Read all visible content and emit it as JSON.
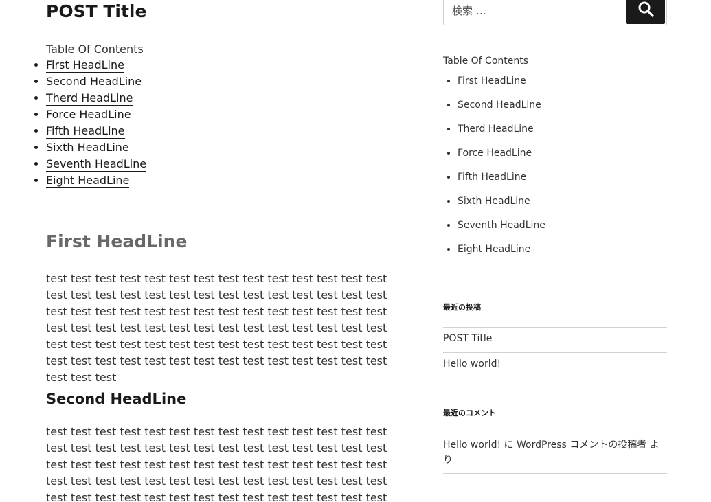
{
  "post": {
    "title": "POST Title",
    "toc_heading": "Table Of Contents",
    "toc_items": [
      "First HeadLine",
      "Second HeadLine",
      "Therd HeadLine",
      "Force HeadLine",
      "Fifth HeadLine",
      "Sixth HeadLine",
      "Seventh HeadLine",
      "Eight HeadLine"
    ],
    "sections": [
      {
        "heading": "First HeadLine",
        "body": "test test test test test test test test test test test test test test test test test test test test test test test test test test test test test test test test test test test test test test test test test test test test test test test test test test test test test test test test test test test test test test test test test test test test test test test test test test test test test test test test test test test test test test test"
      },
      {
        "heading": "Second HeadLine",
        "body": "test test test test test test test test test test test test test test test test test test test test test test test test test test test test test test test test test test test test test test test test test test test test test test test test test test test test test test test test test test test test test test test test test test test test test test"
      }
    ]
  },
  "sidebar": {
    "search": {
      "placeholder": "検索 …",
      "icon": "search-icon"
    },
    "toc_heading": "Table Of Contents",
    "toc_items": [
      "First HeadLine",
      "Second HeadLine",
      "Therd HeadLine",
      "Force HeadLine",
      "Fifth HeadLine",
      "Sixth HeadLine",
      "Seventh HeadLine",
      "Eight HeadLine"
    ],
    "recent_posts": {
      "title": "最近の投稿",
      "items": [
        "POST Title",
        "Hello world!"
      ]
    },
    "recent_comments": {
      "title": "最近のコメント",
      "items": [
        "Hello world! に WordPress コメントの投稿者 より"
      ]
    }
  },
  "colors": {
    "text": "#333333",
    "heading": "#1a1a1a",
    "section_heading": "#686868",
    "border": "#d1d1d1",
    "button": "#1a1a1a"
  }
}
